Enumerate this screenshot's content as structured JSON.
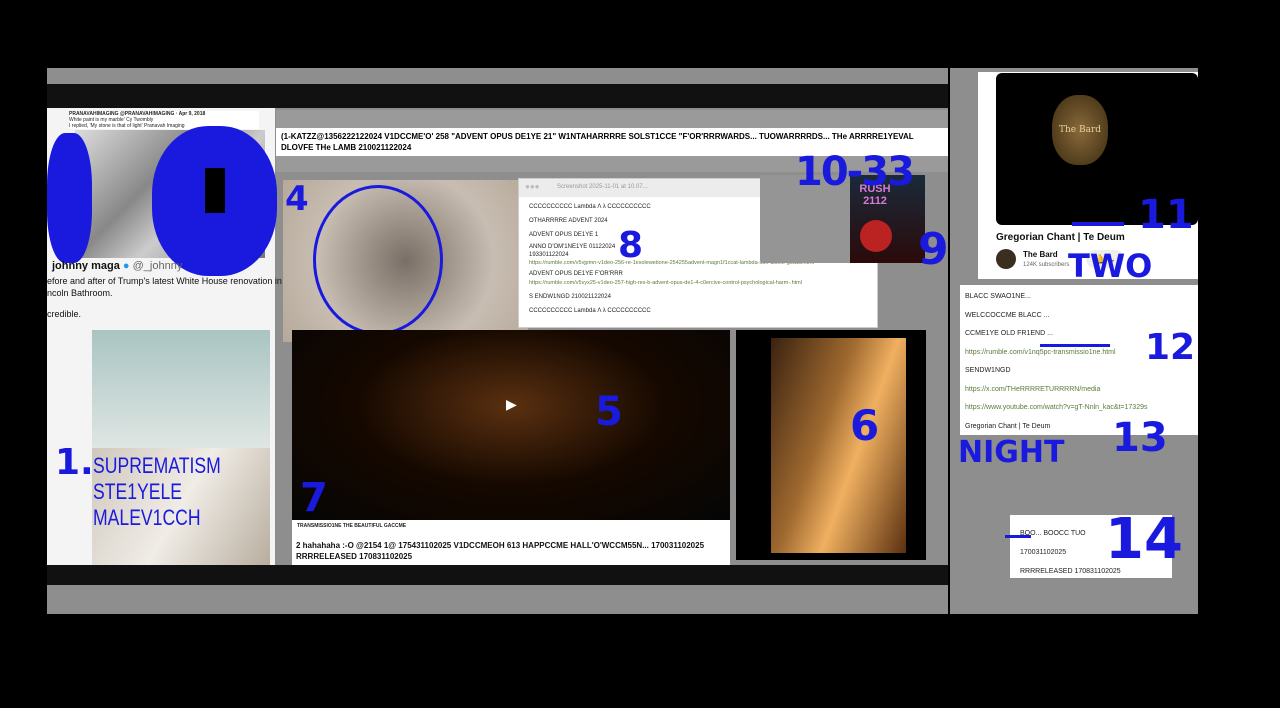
{
  "title_bar": {
    "text": "(1-KATZZ@1356222122024 V1DCCME'O' 258 \"ADVENT OPUS DE1YE 21\" W1NTAHARRRRE SOLST1CCE \"F'OR'RRRWARDS... TUOWARRRRDS... THe ARRRRE1YEVAL DLOVFE THe LAMB 210021122024"
  },
  "left_tweet": {
    "quoted_header": "PRANAVAHIMAGING @PRANAVAHIMAGING · Apr 9, 2018",
    "quoted_line1": "White paint is my marble' Cy Twombly",
    "quoted_line2": "I replied, 'My stone is that of light' Pranavah Imaging",
    "author": "johnny maga",
    "handle": "@_johnny",
    "line1": "efore and after of Trump's latest White House renovation in",
    "line2": "ncoln Bathroom.",
    "line3": "credible.",
    "overlay_text": [
      "SUPREMATISM",
      "STE1YELE",
      "MALEV1CCH"
    ]
  },
  "screenshot_window": {
    "title": "Screenshot 2025-11-01 at 10.07...",
    "lines": [
      {
        "text": "CCCCCCCCCC Lambda Λ λ CCCCCCCCCC",
        "link": false
      },
      {
        "text": "OTHARRRRE ADVENT 2024",
        "link": false
      },
      {
        "text": "ADVENT OPUS DE1YE 1",
        "link": false
      },
      {
        "text": "ANNO D'OM'1NE1YE 01122024",
        "link": false
      },
      {
        "text": "193301122024",
        "link": false
      },
      {
        "text": "https://rumble.com/v5vjpmn-v1deo-256-re-1esolewetione-254255advent-magn1f1ccat-lambda-son-dlovfe-god15.html",
        "link": true
      },
      {
        "text": "ADVENT OPUS DE1YE F'OR'RRR",
        "link": false
      },
      {
        "text": "https://rumble.com/v5vyx25-v1deo-257-high-res-b-advent-opus-de1-4-c0ercive-control-psychological-harm-.html",
        "link": true
      },
      {
        "text": "S ENDW1NGD 210021122024",
        "link": false
      },
      {
        "text": "CCCCCCCCCC Lambda Λ λ CCCCCCCCCC",
        "link": false
      }
    ]
  },
  "poster": {
    "text": "RUSH 2112"
  },
  "video_caption": {
    "small": "TRANSMISSIO1NE THE BEAUTIFUL GACCME",
    "line1": "2 hahahaha :-O @2154 1@ 175431102025 V1DCCMEOH 613 HAPPCCME HALL'O'WCCM55N... 170031102025",
    "line2": "RRRRELEASED 170831102025"
  },
  "channel": {
    "logo_text": "The Bard",
    "video_title": "Gregorian Chant | Te Deum",
    "name": "The Bard",
    "subscribers": "124K subscribers"
  },
  "right_list": [
    {
      "text": "BLACC SWAO1NE...",
      "link": false
    },
    {
      "text": "WELCCOCCME BLACC ...",
      "link": false
    },
    {
      "text": "CCME1YE OLD FR1END ...",
      "link": false
    },
    {
      "text": "https://rumble.com/v1nq5pc-transmissio1ne.html",
      "link": true
    },
    {
      "text": "SENDW1NGD",
      "link": false
    },
    {
      "text": "https://x.com/THeRRRRETURRRRN/media",
      "link": true
    },
    {
      "text": "https://www.youtube.com/watch?v=gT-Nnln_kac&t=17329s",
      "link": true
    },
    {
      "text": "Gregorian Chant | Te Deum",
      "link": false
    }
  ],
  "small_card": [
    "BOO... BOOCC TUO",
    "170031102025",
    "RRRRELEASED 170831102025"
  ],
  "annotations": {
    "a1": "1.",
    "a4": "4",
    "a5": "5",
    "a6": "6",
    "a7": "7",
    "a8": "8",
    "a9": "9",
    "a10": "10-33",
    "a11": "11",
    "two": "TWO",
    "a12": "12",
    "a13": "13",
    "night": "NIGHT",
    "a14": "14"
  },
  "colors": {
    "annotation": "#1a1adf",
    "link": "#5a7a3a"
  }
}
